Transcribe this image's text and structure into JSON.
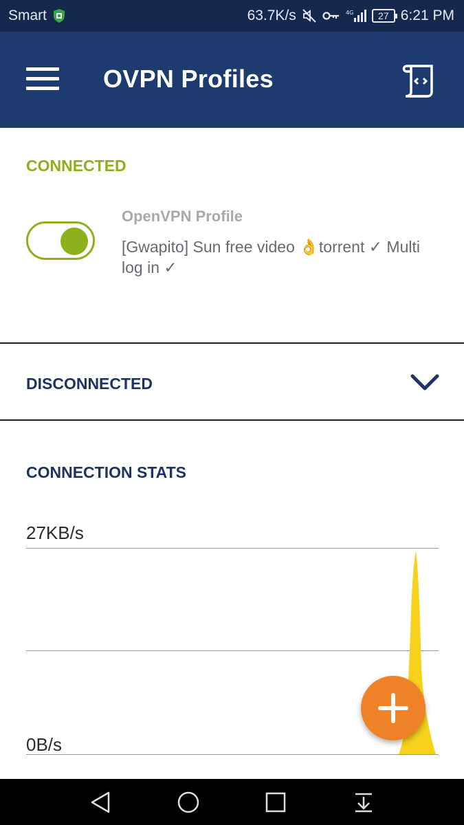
{
  "status_bar": {
    "carrier": "Smart",
    "net_speed": "63.7K/s",
    "battery": "27",
    "time": "6:21 PM",
    "icons": [
      "shield-icon",
      "mute-icon",
      "key-icon",
      "4g-signal-icon",
      "battery-icon"
    ]
  },
  "app_bar": {
    "title": "OVPN Profiles",
    "menu_icon": "hamburger-icon",
    "log_icon": "log-scroll-icon",
    "color": "#1d3b6f"
  },
  "connected": {
    "label": "CONNECTED",
    "profile_kind": "OpenVPN Profile",
    "profile_name": "[Gwapito] Sun free video 👌torrent ✓ Multi log in ✓",
    "toggle_on": true,
    "accent": "#8cb11a"
  },
  "disconnected": {
    "label": "DISCONNECTED",
    "icon": "chevron-down-icon"
  },
  "stats": {
    "label": "CONNECTION STATS",
    "max_label": "27KB/s",
    "min_label": "0B/s",
    "series_color": "#f6d21c"
  },
  "fab": {
    "icon": "plus-icon",
    "color": "#ef8227"
  },
  "nav_bar": {
    "icons": [
      "back-icon",
      "home-icon",
      "recents-icon",
      "notifications-pull-icon"
    ]
  }
}
